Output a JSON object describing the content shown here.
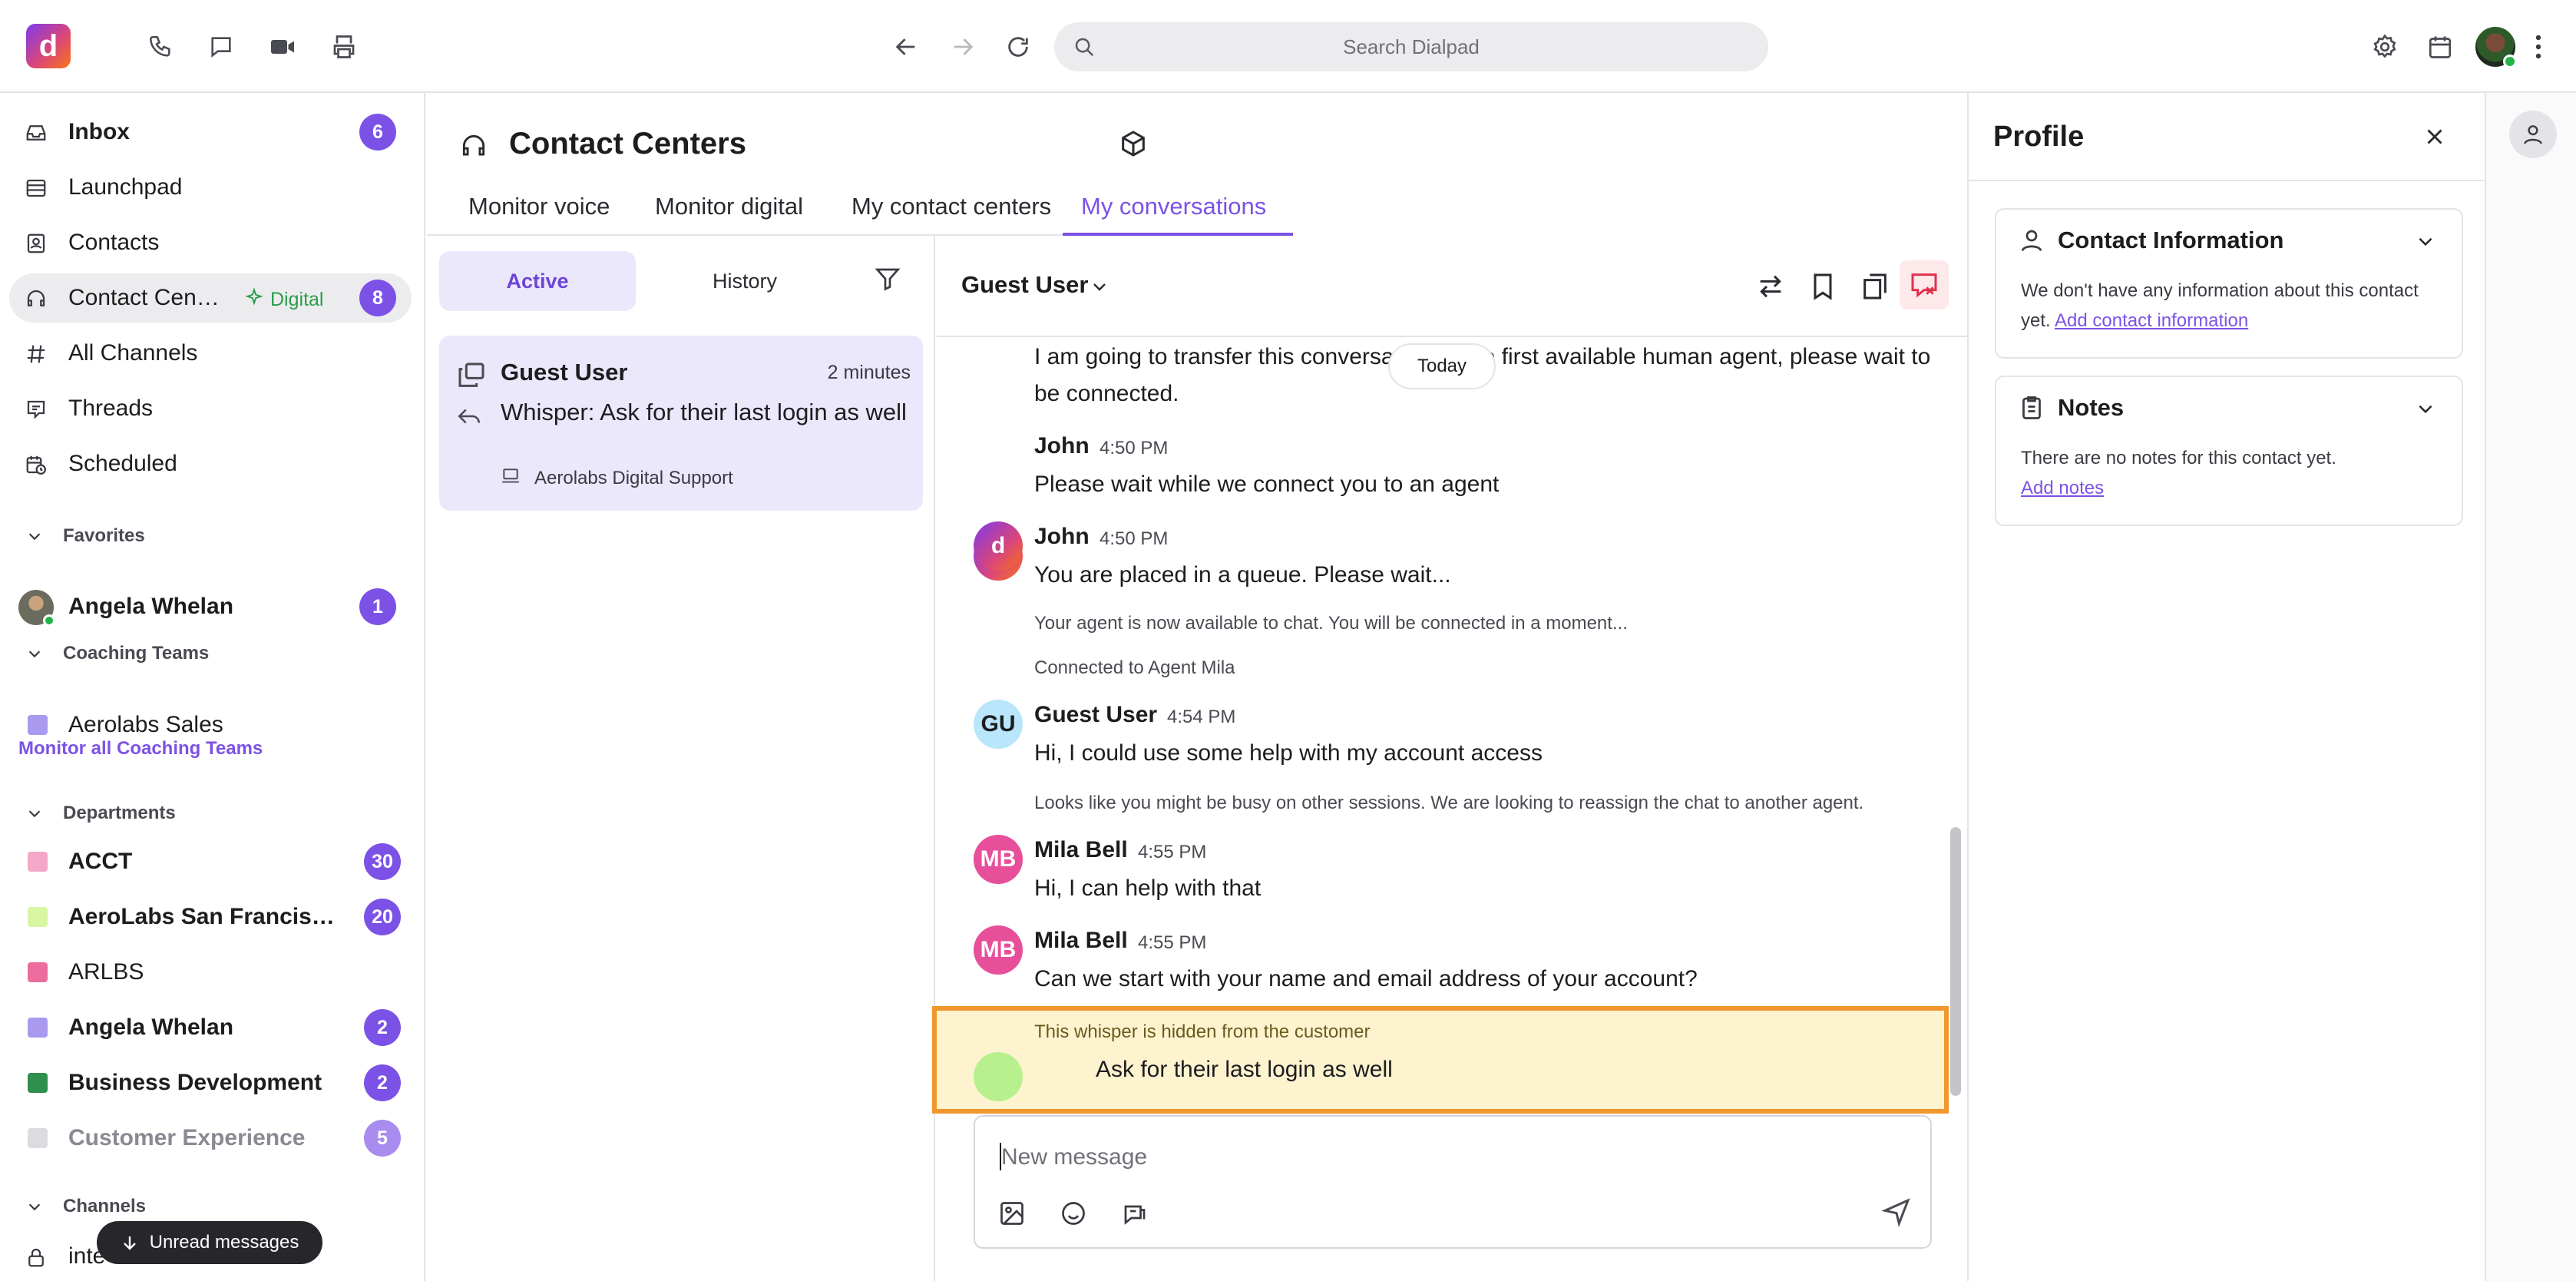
{
  "topbar": {
    "search_placeholder": "Search Dialpad"
  },
  "sidebar": {
    "inbox": {
      "label": "Inbox",
      "count": "6"
    },
    "launchpad": {
      "label": "Launchpad"
    },
    "contacts": {
      "label": "Contacts"
    },
    "contact_centers": {
      "label": "Contact Cen…",
      "tag": "Digital",
      "count": "8"
    },
    "all_channels": {
      "label": "All Channels"
    },
    "threads": {
      "label": "Threads"
    },
    "scheduled": {
      "label": "Scheduled"
    },
    "favorites_title": "Favorites",
    "favorites": [
      {
        "label": "Angela Whelan",
        "count": "1"
      }
    ],
    "coaching_title": "Coaching Teams",
    "coaching": [
      {
        "label": "Aerolabs Sales",
        "color": "#a99af0"
      }
    ],
    "monitor_link": "Monitor all Coaching Teams",
    "departments_title": "Departments",
    "departments": [
      {
        "label": "ACCT",
        "count": "30",
        "color": "#f4a7c7"
      },
      {
        "label": "AeroLabs San Francis…",
        "count": "20",
        "color": "#d8f5a2"
      },
      {
        "label": "ARLBS",
        "count": "",
        "color": "#ec6c9e"
      },
      {
        "label": "Angela Whelan",
        "count": "2",
        "color": "#a99af0"
      },
      {
        "label": "Business Development",
        "count": "2",
        "color": "#2f8f4e"
      },
      {
        "label": "Customer Experience",
        "count": "5",
        "color": "#dcdce0"
      }
    ],
    "channels_title": "Channels",
    "channel_partial": "inte",
    "unread_button": "Unread messages"
  },
  "contact_center": {
    "title": "Contact Centers",
    "tabs": [
      "Monitor voice",
      "Monitor digital",
      "My contact centers",
      "My conversations"
    ],
    "active_tab": "My conversations"
  },
  "conversation_list": {
    "segments": [
      "Active",
      "History"
    ],
    "items": [
      {
        "name": "Guest User",
        "time": "2 minutes",
        "preview": "Whisper: Ask for their last login as well",
        "source": "Aerolabs Digital Support"
      }
    ]
  },
  "chat": {
    "contact_name": "Guest User",
    "date_divider": "Today",
    "messages": [
      {
        "text": "I am going to transfer this conversation to the first available human agent, please wait to be connected."
      },
      {
        "author": "John",
        "time": "4:50 PM",
        "text": "Please wait while we connect you to an agent",
        "initials": "d"
      },
      {
        "author": "John",
        "time": "4:50 PM",
        "text": "You are placed in a queue. Please wait...",
        "initials": "d"
      }
    ],
    "system1": "Your agent is now available to chat. You will be connected in a moment...",
    "system2": "Connected to Agent Mila",
    "guest_msg": {
      "author": "Guest User",
      "time": "4:54 PM",
      "text": "Hi, I could use some help with my account access",
      "initials": "GU"
    },
    "system3": "Looks like you might be busy on other sessions. We are looking to reassign the chat to another agent.",
    "mila_msgs": [
      {
        "author": "Mila Bell",
        "time": "4:55 PM",
        "text": "Hi, I can help with that",
        "initials": "MB"
      },
      {
        "author": "Mila Bell",
        "time": "4:55 PM",
        "text": "Can we start with your name and email address of your account?",
        "initials": "MB"
      }
    ],
    "whisper": {
      "note": "This whisper is hidden from the customer",
      "text": "Ask for their last login as well"
    },
    "composer_placeholder": "New message"
  },
  "profile": {
    "title": "Profile",
    "contact_info": {
      "title": "Contact Information",
      "text": "We don't have any information about this contact yet.",
      "link": "Add contact information"
    },
    "notes": {
      "title": "Notes",
      "text": "There are no notes for this contact yet.",
      "link": "Add notes"
    }
  }
}
